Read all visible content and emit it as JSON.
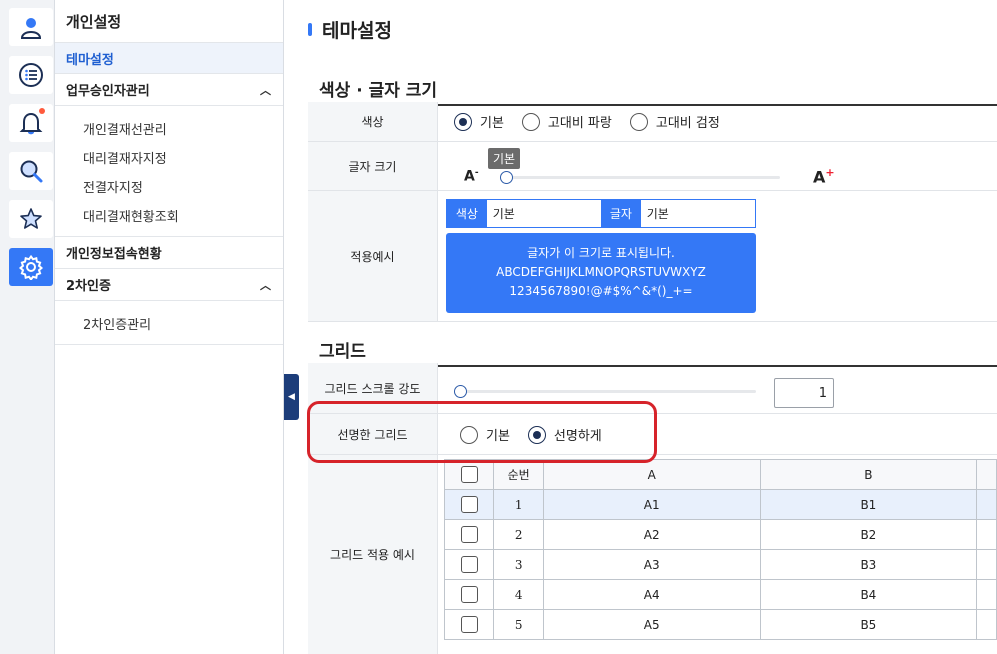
{
  "rail": {
    "items": [
      {
        "icon": "user-icon"
      },
      {
        "icon": "list-icon"
      },
      {
        "icon": "bell-icon"
      },
      {
        "icon": "search-icon"
      },
      {
        "icon": "star-icon"
      },
      {
        "icon": "gear-icon",
        "active": true
      }
    ],
    "accent": "#3478f6"
  },
  "submenu": {
    "title": "개인설정",
    "active_item": "테마설정",
    "group1": {
      "label": "업무승인자관리",
      "items": [
        "개인결재선관리",
        "대리결재자지정",
        "전결자지정",
        "대리결재현황조회"
      ]
    },
    "group2": {
      "label": "개인정보접속현황"
    },
    "group3": {
      "label": "2차인증",
      "items": [
        "2차인증관리"
      ]
    }
  },
  "main": {
    "title": "테마설정",
    "section1": {
      "title": "색상 · 글자 크기",
      "color": {
        "label": "색상",
        "options": [
          "기본",
          "고대비 파랑",
          "고대비 검정"
        ],
        "selected": 0
      },
      "fontsize": {
        "label": "글자 크기",
        "tooltip": "기본",
        "min_icon": "A",
        "min_sup": "-",
        "max_icon": "A",
        "max_sup": "+"
      },
      "preview": {
        "label": "적용예시",
        "color_key": "색상",
        "color_val": "기본",
        "font_key": "글자",
        "font_val": "기본",
        "lines": [
          "글자가 이 크기로 표시됩니다.",
          "ABCDEFGHIJKLMNOPQRSTUVWXYZ",
          "1234567890!@#$%^&*()_+="
        ]
      }
    },
    "section2": {
      "title": "그리드",
      "scroll": {
        "label": "그리드 스크롤 강도",
        "value": "1"
      },
      "sharp": {
        "label": "선명한 그리드",
        "options": [
          "기본",
          "선명하게"
        ],
        "selected": 1
      },
      "example": {
        "label": "그리드 적용 예시",
        "headers": [
          "순번",
          "A",
          "B"
        ],
        "rows": [
          {
            "no": "1",
            "a": "A1",
            "b": "B1"
          },
          {
            "no": "2",
            "a": "A2",
            "b": "B2"
          },
          {
            "no": "3",
            "a": "A3",
            "b": "B3"
          },
          {
            "no": "4",
            "a": "A4",
            "b": "B4"
          },
          {
            "no": "5",
            "a": "A5",
            "b": "B5"
          }
        ]
      }
    }
  }
}
